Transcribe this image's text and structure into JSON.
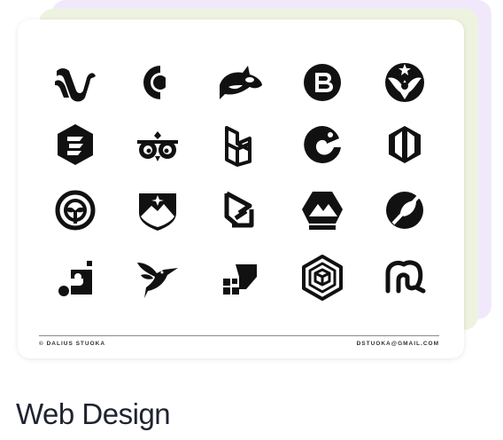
{
  "card": {
    "credit": "© DALIUS STUOKA",
    "email": "DSTUOKA@GMAIL.COM"
  },
  "logos": [
    "swan-logo-icon",
    "crescent-c-logo-icon",
    "orca-logo-icon",
    "letter-b-circle-logo-icon",
    "phoenix-logo-icon",
    "hexagon-s-logo-icon",
    "owl-eyes-logo-icon",
    "isometric-b-logo-icon",
    "chameleon-logo-icon",
    "hexagon-split-logo-icon",
    "leaf-circle-logo-icon",
    "mountain-shield-logo-icon",
    "triangle-loop-logo-icon",
    "mountain-hexagon-logo-icon",
    "leaf-slash-circle-logo-icon",
    "dot-square-logo-icon",
    "hummingbird-logo-icon",
    "pixel-arrow-logo-icon",
    "cube-hexagon-logo-icon",
    "elephant-logo-icon"
  ],
  "caption": "Web Design"
}
